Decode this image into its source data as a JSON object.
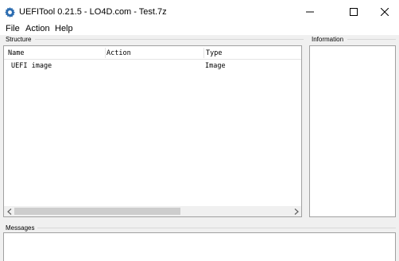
{
  "window": {
    "title": "UEFITool 0.21.5 - LO4D.com - Test.7z",
    "minimize_label": "minimize",
    "maximize_label": "maximize",
    "close_label": "close"
  },
  "menu": {
    "items": [
      {
        "label": "File"
      },
      {
        "label": "Action"
      },
      {
        "label": "Help"
      }
    ]
  },
  "structure": {
    "label": "Structure",
    "columns": [
      "Name",
      "Action",
      "Type"
    ],
    "rows": [
      {
        "name": "UEFI image",
        "action": "",
        "type": "Image"
      }
    ]
  },
  "information": {
    "label": "Information"
  },
  "messages": {
    "label": "Messages"
  },
  "icons": {
    "app": "gear-icon",
    "minimize": "minimize-icon",
    "maximize": "maximize-icon",
    "close": "close-icon",
    "scroll_left": "chevron-left-icon",
    "scroll_right": "chevron-right-icon"
  }
}
